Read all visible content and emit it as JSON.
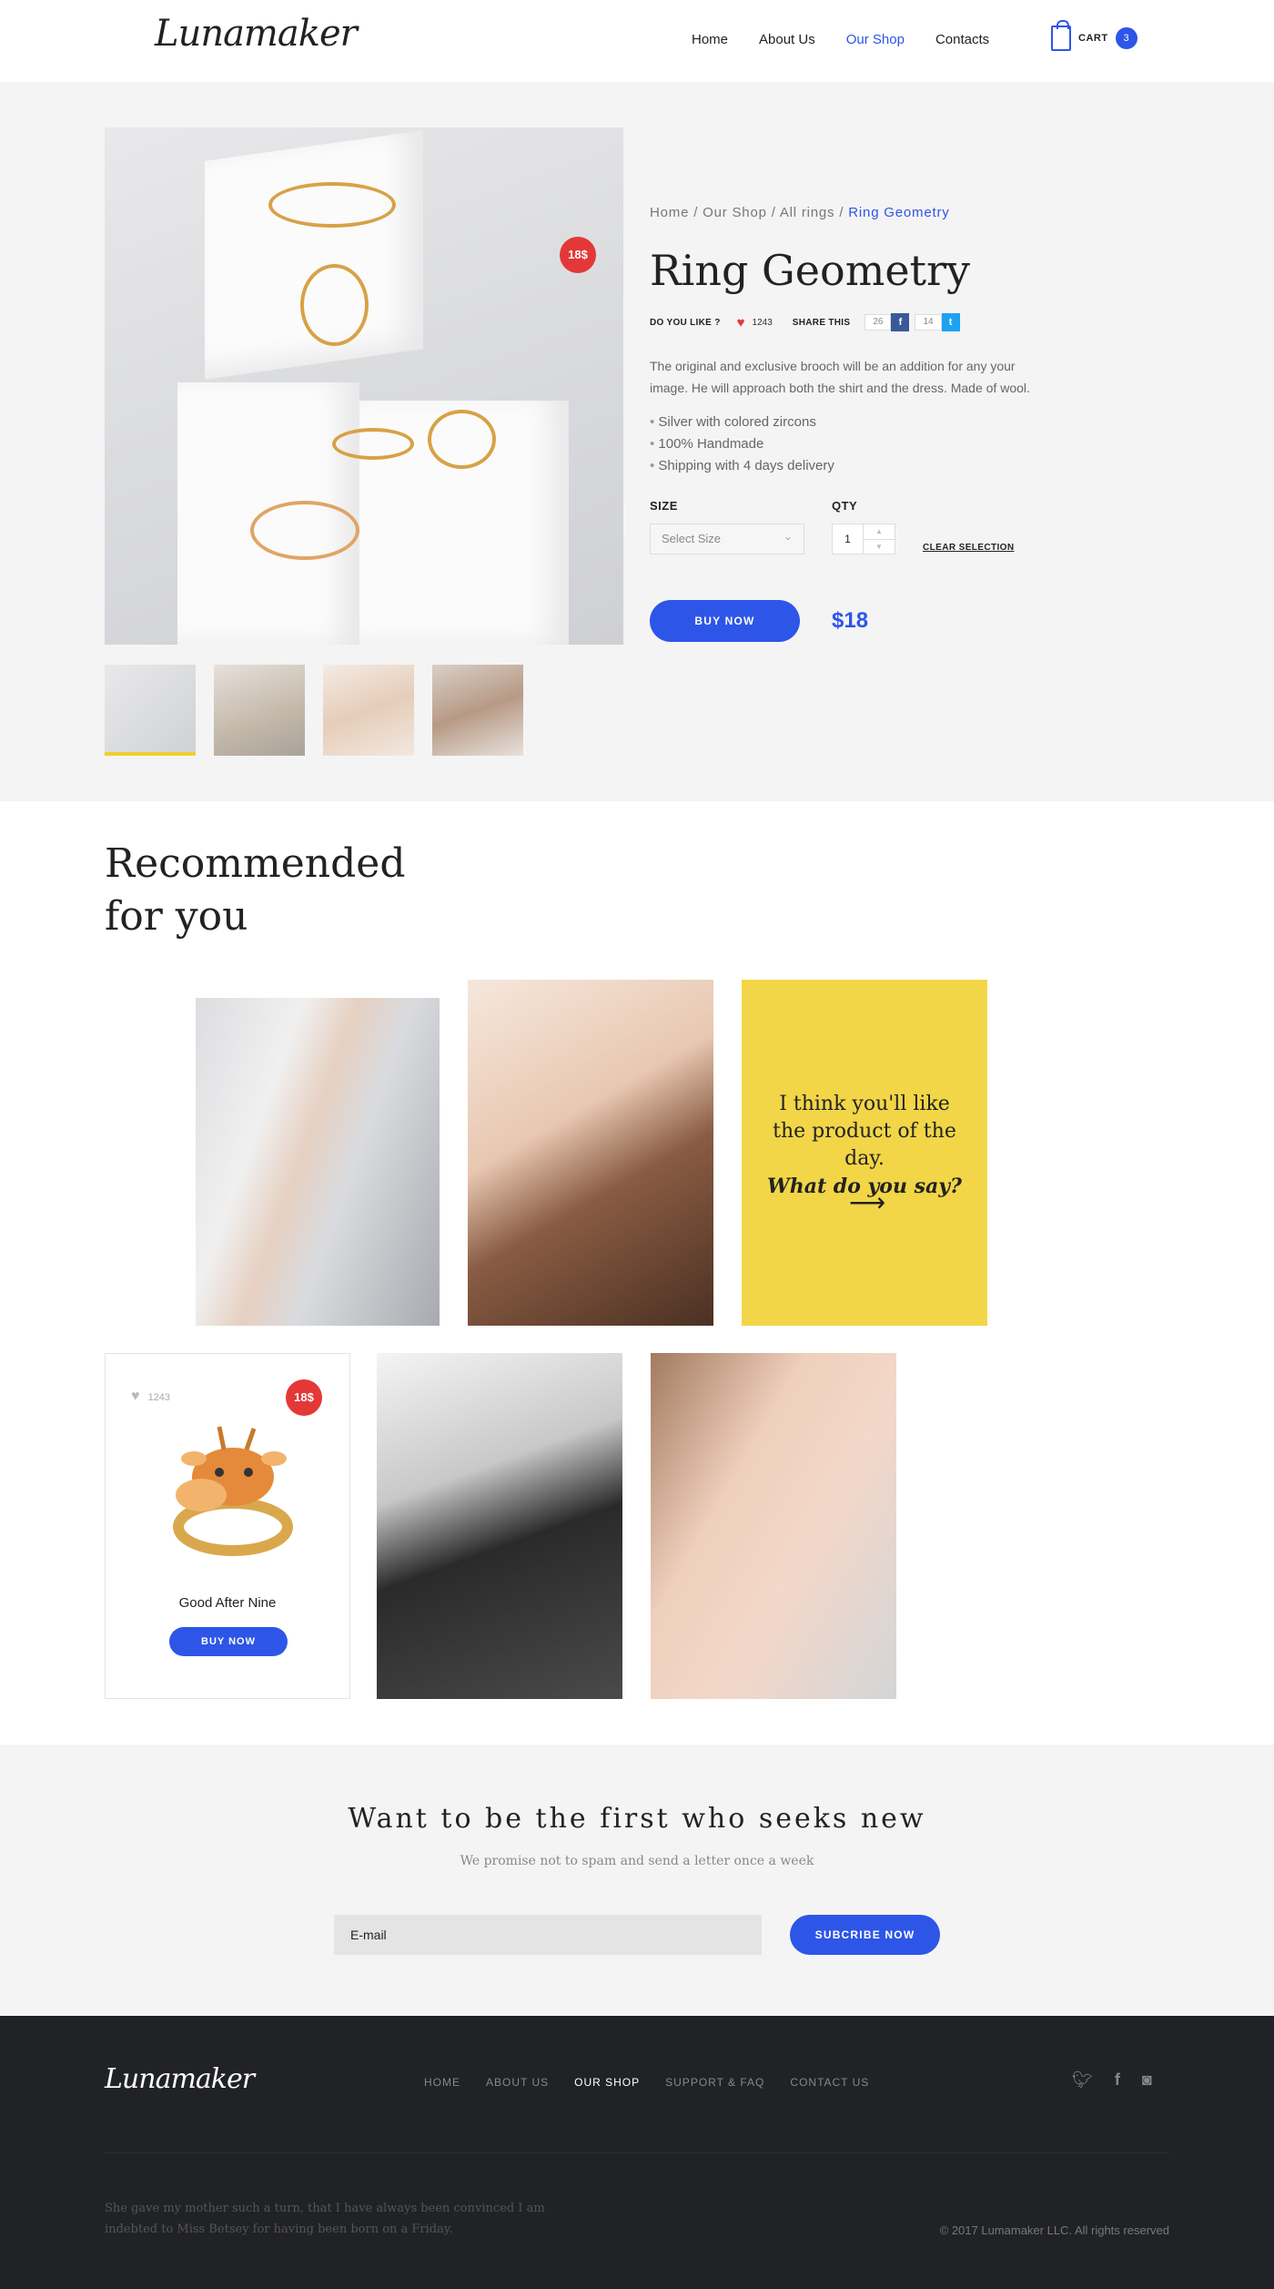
{
  "header": {
    "logo": "Lunamaker",
    "nav": [
      "Home",
      "About Us",
      "Our Shop",
      "Contacts"
    ],
    "nav_active": "Our Shop",
    "cart_label": "CART",
    "cart_count": "3"
  },
  "product": {
    "breadcrumb": [
      "Home",
      "Our Shop",
      "All rings",
      "Ring Geometry"
    ],
    "title": "Ring Geometry",
    "price_badge": "18$",
    "like_label": "DO YOU LIKE ?",
    "like_count": "1243",
    "share_label": "SHARE THIS",
    "fb_count": "26",
    "tw_count": "14",
    "description": "The original and exclusive brooch will be an addition for any your image. He will approach both the shirt and the dress. Made of wool.",
    "features": [
      "Silver with colored zircons",
      "100% Handmade",
      "Shipping with 4 days delivery"
    ],
    "size_label": "SIZE",
    "size_placeholder": "Select Size",
    "qty_label": "QTY",
    "qty_value": "1",
    "clear_label": "CLEAR SELECTION",
    "buy_label": "BUY NOW",
    "price": "$18"
  },
  "recommended": {
    "title_line1": "Recommended",
    "title_line2": "for you",
    "promo_text": "I think you'll like the product of the day.",
    "promo_emphasis": "What do you say?",
    "promo_arrow": "⟶",
    "card": {
      "likes": "1243",
      "badge": "18$",
      "name": "Good After Nine",
      "button": "BUY NOW"
    }
  },
  "newsletter": {
    "title": "Want to be the first who seeks new",
    "subtitle": "We promise not to spam and send a letter once a week",
    "email_placeholder": "E-mail",
    "button": "SUBCRIBE NOW"
  },
  "footer": {
    "logo": "Lunamaker",
    "nav": [
      "HOME",
      "ABOUT US",
      "OUR SHOP",
      "SUPPORT & FAQ",
      "CONTACT US"
    ],
    "nav_active": "OUR SHOP",
    "social": [
      "twitter-icon",
      "facebook-icon",
      "instagram-icon"
    ],
    "quote": "She gave my mother such a turn, that I have always been convinced I am indebted to Miss Betsey for having been born on a Friday.",
    "copyright": "© 2017 Lumamaker LLC. All rights reserved"
  },
  "colors": {
    "accent": "#2d55e8",
    "badge": "#e43838",
    "promo": "#f2d647",
    "footer_bg": "#212226"
  }
}
